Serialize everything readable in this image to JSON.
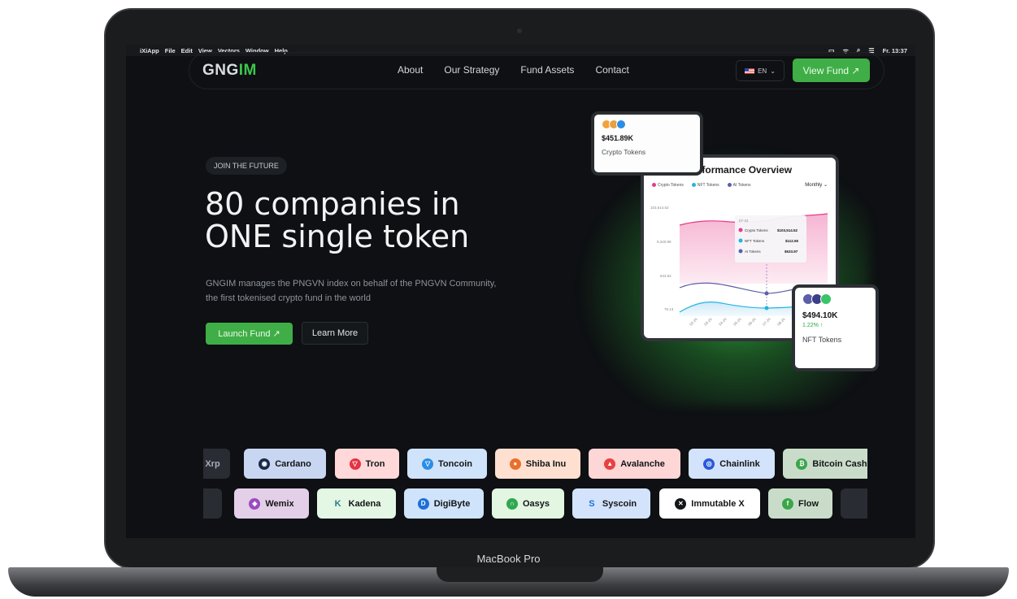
{
  "device": {
    "label": "MacBook Pro"
  },
  "menubar": {
    "app": "iXiApp",
    "items": [
      "File",
      "Edit",
      "View",
      "Vectors",
      "Window",
      "Help"
    ],
    "clock": "Fr. 13:37"
  },
  "nav": {
    "logo_main": "GNG",
    "logo_accent": "IM",
    "links": [
      "About",
      "Our Strategy",
      "Fund Assets",
      "Contact"
    ],
    "language": "EN",
    "cta": "View Fund ↗"
  },
  "hero": {
    "badge": "JOIN THE FUTURE",
    "headline_line1": "80 companies in",
    "headline_line2": "ONE single token",
    "subtext": "GNGIM manages the PNGVN index on behalf of the PNGVN Community, the first tokenised crypto fund in the world",
    "launch": "Launch Fund ↗",
    "learn": "Learn More"
  },
  "card_small": {
    "value": "$451.89K",
    "label": "Crypto Tokens"
  },
  "market": {
    "title": "Market Performance Overview",
    "legend": [
      "Crypto Tokens",
      "NFT Tokens",
      "AI Tokens"
    ],
    "period": "Monthly ⌄",
    "tooltip": {
      "date": "07-24",
      "rows": [
        {
          "name": "Crypto Tokens",
          "value": "$103,514.52"
        },
        {
          "name": "NFT Tokens",
          "value": "$112.55"
        },
        {
          "name": "AI Tokens",
          "value": "$633.97"
        }
      ]
    }
  },
  "chart_data": {
    "type": "line",
    "x": [
      "02-24",
      "03-24",
      "04-24",
      "05-24",
      "06-24",
      "07-24",
      "08-24"
    ],
    "yticks": [
      "103,514.52",
      "9,340.99",
      "843.62",
      "76.13"
    ],
    "series": [
      {
        "name": "Crypto Tokens",
        "color": "#e43b8a"
      },
      {
        "name": "NFT Tokens",
        "color": "#22b4e6"
      },
      {
        "name": "AI Tokens",
        "color": "#5b5fa8"
      }
    ]
  },
  "card_right": {
    "value": "$494.10K",
    "change": "1.22% ↑",
    "label": "NFT Tokens"
  },
  "tokens_row1": [
    "Xrp",
    "Cardano",
    "Tron",
    "Toncoin",
    "Shiba Inu",
    "Avalanche",
    "Chainlink",
    "Bitcoin Cash"
  ],
  "tokens_row2": [
    "",
    "Wemix",
    "Kadena",
    "DigiByte",
    "Oasys",
    "Syscoin",
    "Immutable X",
    "Flow",
    ""
  ],
  "colors": {
    "accent": "#3fae46",
    "background": "#0e1013"
  }
}
